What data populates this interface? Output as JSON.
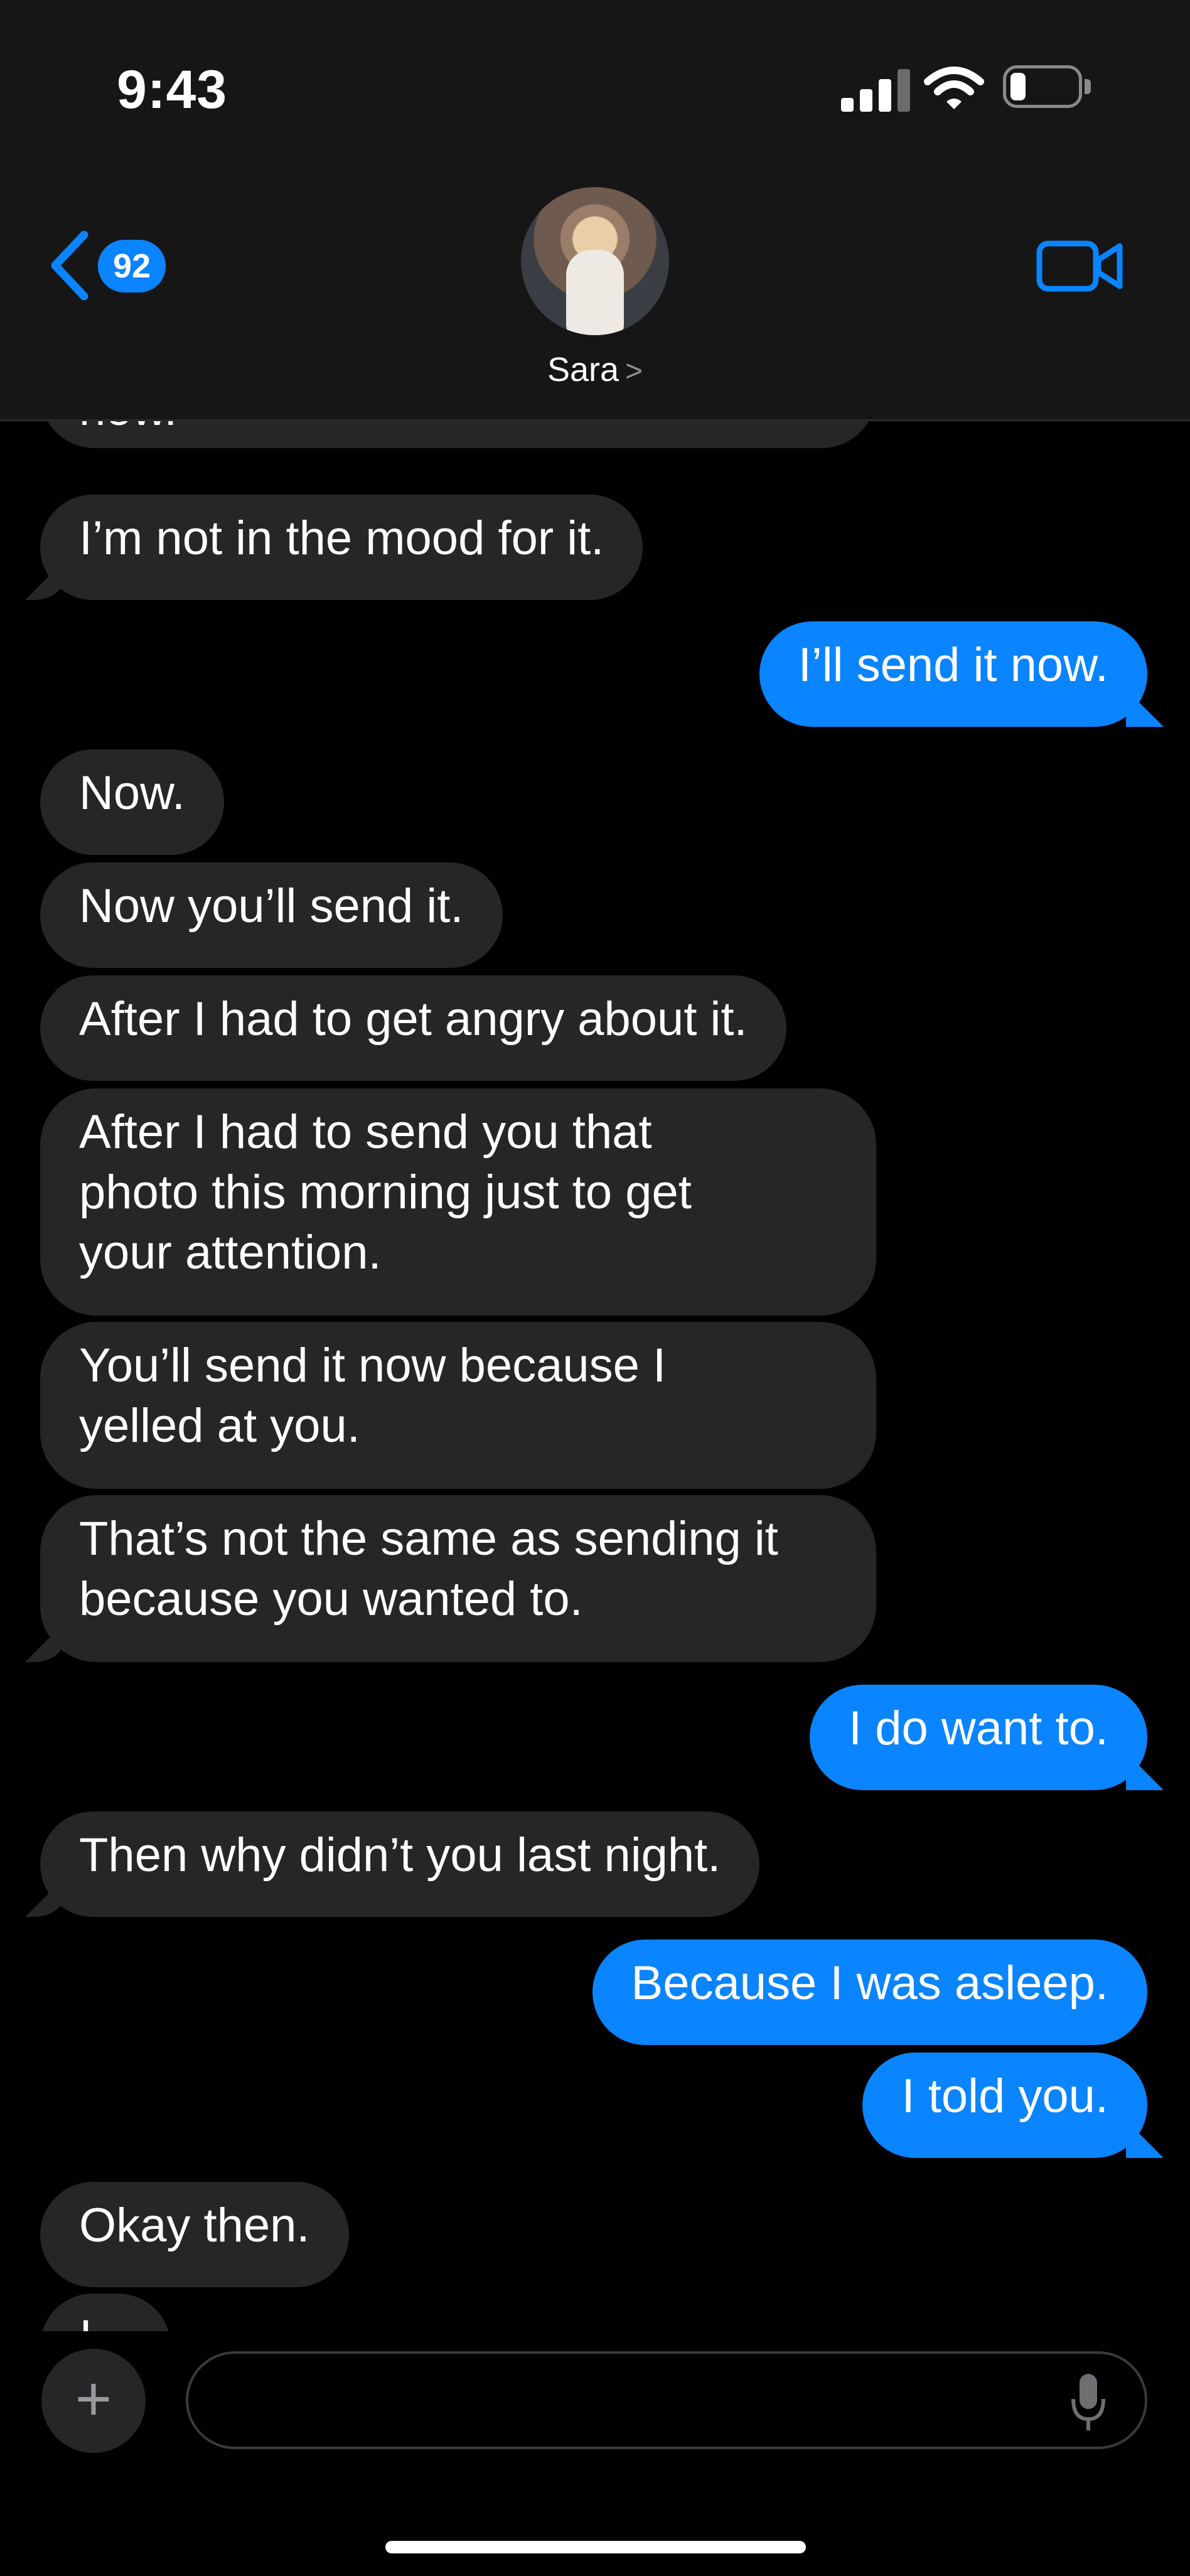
{
  "status_bar": {
    "time": "9:43"
  },
  "header": {
    "unread_count": "92",
    "contact_name": "Sara",
    "chevron": ">"
  },
  "messages": [
    {
      "dir": "in",
      "text": "now."
    },
    {
      "dir": "in",
      "text": "I’m not in the mood for it."
    },
    {
      "dir": "out",
      "text": "I’ll send it now."
    },
    {
      "dir": "in",
      "text": "Now."
    },
    {
      "dir": "in",
      "text": "Now you’ll send it."
    },
    {
      "dir": "in",
      "text": "After I had to get angry about it."
    },
    {
      "dir": "in",
      "text": "After I had to send you that\nphoto this morning just to get\nyour attention."
    },
    {
      "dir": "in",
      "text": "You’ll send it now because I\nyelled at you."
    },
    {
      "dir": "in",
      "text": "That’s not the same as sending it\nbecause you wanted to."
    },
    {
      "dir": "out",
      "text": "I do want to."
    },
    {
      "dir": "in",
      "text": "Then why didn’t you last night."
    },
    {
      "dir": "out",
      "text": "Because I was asleep."
    },
    {
      "dir": "out",
      "text": "I told you."
    },
    {
      "dir": "in",
      "text": "Okay then."
    },
    {
      "dir": "in",
      "text": "I..."
    }
  ],
  "input": {
    "plus_label": "+",
    "placeholder": ""
  },
  "icons": {
    "back": "chevron-left-icon",
    "video": "video-camera-icon",
    "mic": "microphone-icon",
    "add": "plus-icon"
  },
  "colors": {
    "blue": "#0a84ff",
    "incoming": "#262628",
    "background": "#000000"
  }
}
